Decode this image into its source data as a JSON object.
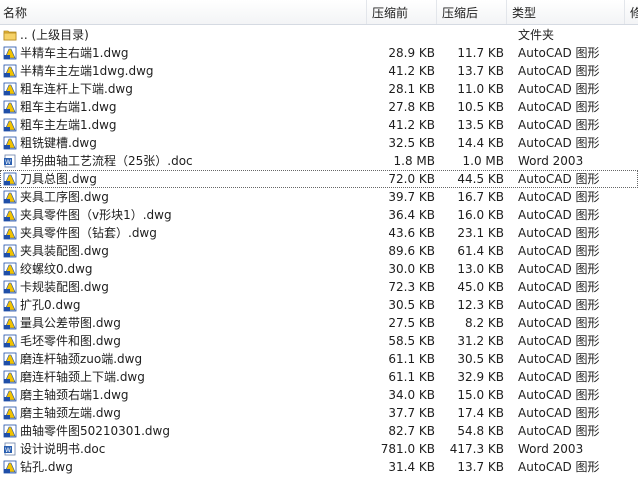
{
  "header": {
    "name": "名称",
    "original_size": "压缩前",
    "compressed_size": "压缩后",
    "type": "类型",
    "last": "修"
  },
  "rows": [
    {
      "name": ".. (上级目录)",
      "osize": "",
      "csize": "",
      "type": "文件夹",
      "icon": "folder-icon"
    },
    {
      "name": "半精车主右端1.dwg",
      "osize": "28.9 KB",
      "csize": "11.7 KB",
      "type": "AutoCAD 图形",
      "icon": "autocad-file-icon"
    },
    {
      "name": "半精车主左端1dwg.dwg",
      "osize": "41.2 KB",
      "csize": "13.7 KB",
      "type": "AutoCAD 图形",
      "icon": "autocad-file-icon"
    },
    {
      "name": "粗车连杆上下端.dwg",
      "osize": "28.1 KB",
      "csize": "11.0 KB",
      "type": "AutoCAD 图形",
      "icon": "autocad-file-icon"
    },
    {
      "name": "粗车主右端1.dwg",
      "osize": "27.8 KB",
      "csize": "10.5 KB",
      "type": "AutoCAD 图形",
      "icon": "autocad-file-icon"
    },
    {
      "name": "粗车主左端1.dwg",
      "osize": "41.2 KB",
      "csize": "13.5 KB",
      "type": "AutoCAD 图形",
      "icon": "autocad-file-icon"
    },
    {
      "name": "粗铣键槽.dwg",
      "osize": "32.5 KB",
      "csize": "14.4 KB",
      "type": "AutoCAD 图形",
      "icon": "autocad-file-icon"
    },
    {
      "name": "单拐曲轴工艺流程（25张）.doc",
      "osize": "1.8 MB",
      "csize": "1.0 MB",
      "type": "Word 2003",
      "icon": "word-doc-icon"
    },
    {
      "name": "刀具总图.dwg",
      "osize": "72.0 KB",
      "csize": "44.5 KB",
      "type": "AutoCAD 图形",
      "icon": "autocad-file-icon"
    },
    {
      "name": "夹具工序图.dwg",
      "osize": "39.7 KB",
      "csize": "16.7 KB",
      "type": "AutoCAD 图形",
      "icon": "autocad-file-icon"
    },
    {
      "name": "夹具零件图（v形块1）.dwg",
      "osize": "36.4 KB",
      "csize": "16.0 KB",
      "type": "AutoCAD 图形",
      "icon": "autocad-file-icon"
    },
    {
      "name": "夹具零件图（钻套）.dwg",
      "osize": "43.6 KB",
      "csize": "23.1 KB",
      "type": "AutoCAD 图形",
      "icon": "autocad-file-icon"
    },
    {
      "name": "夹具装配图.dwg",
      "osize": "89.6 KB",
      "csize": "61.4 KB",
      "type": "AutoCAD 图形",
      "icon": "autocad-file-icon"
    },
    {
      "name": "绞螺纹0.dwg",
      "osize": "30.0 KB",
      "csize": "13.0 KB",
      "type": "AutoCAD 图形",
      "icon": "autocad-file-icon"
    },
    {
      "name": "卡规装配图.dwg",
      "osize": "72.3 KB",
      "csize": "45.0 KB",
      "type": "AutoCAD 图形",
      "icon": "autocad-file-icon"
    },
    {
      "name": "扩孔0.dwg",
      "osize": "30.5 KB",
      "csize": "12.3 KB",
      "type": "AutoCAD 图形",
      "icon": "autocad-file-icon"
    },
    {
      "name": "量具公差带图.dwg",
      "osize": "27.5 KB",
      "csize": "8.2 KB",
      "type": "AutoCAD 图形",
      "icon": "autocad-file-icon"
    },
    {
      "name": "毛坯零件和图.dwg",
      "osize": "58.5 KB",
      "csize": "31.2 KB",
      "type": "AutoCAD 图形",
      "icon": "autocad-file-icon"
    },
    {
      "name": "磨连杆轴颈zuo端.dwg",
      "osize": "61.1 KB",
      "csize": "30.5 KB",
      "type": "AutoCAD 图形",
      "icon": "autocad-file-icon"
    },
    {
      "name": "磨连杆轴颈上下端.dwg",
      "osize": "61.1 KB",
      "csize": "32.9 KB",
      "type": "AutoCAD 图形",
      "icon": "autocad-file-icon"
    },
    {
      "name": "磨主轴颈右端1.dwg",
      "osize": "34.0 KB",
      "csize": "15.0 KB",
      "type": "AutoCAD 图形",
      "icon": "autocad-file-icon"
    },
    {
      "name": "磨主轴颈左端.dwg",
      "osize": "37.7 KB",
      "csize": "17.4 KB",
      "type": "AutoCAD 图形",
      "icon": "autocad-file-icon"
    },
    {
      "name": "曲轴零件图50210301.dwg",
      "osize": "82.7 KB",
      "csize": "54.8 KB",
      "type": "AutoCAD 图形",
      "icon": "autocad-file-icon"
    },
    {
      "name": "设计说明书.doc",
      "osize": "781.0 KB",
      "csize": "417.3 KB",
      "type": "Word 2003",
      "icon": "word-doc-icon"
    },
    {
      "name": "钻孔.dwg",
      "osize": "31.4 KB",
      "csize": "13.7 KB",
      "type": "AutoCAD 图形",
      "icon": "autocad-file-icon"
    }
  ],
  "focused_row": 8,
  "colors": {
    "folder": "#e8b83a",
    "autocad_blue": "#1f4fa8",
    "autocad_yellow": "#f2c200",
    "word_blue": "#2a5fb0"
  }
}
